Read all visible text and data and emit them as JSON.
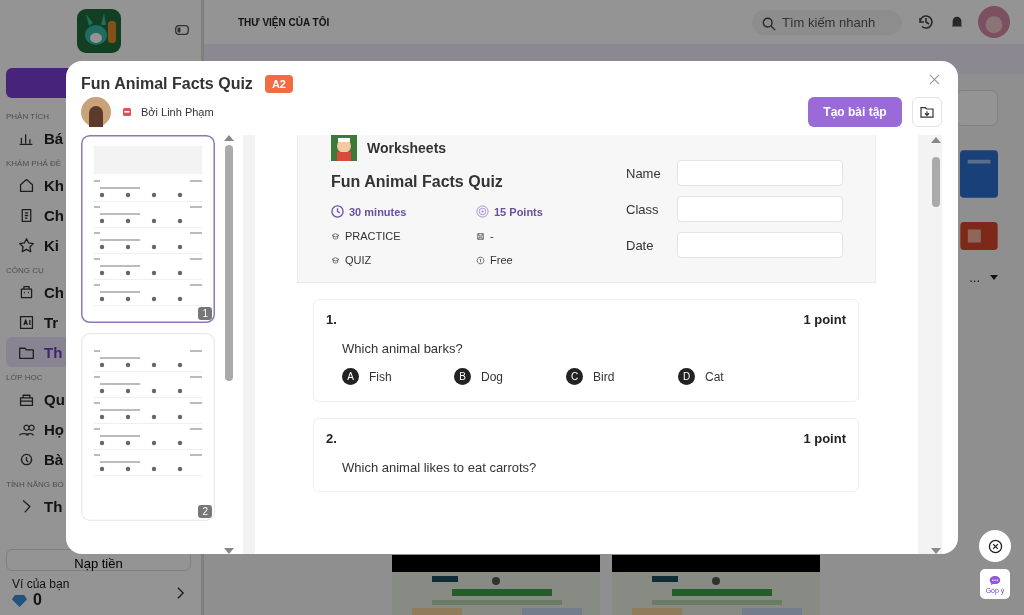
{
  "sidebar": {
    "sections": [
      {
        "heading": "PHÂN TÍCH",
        "items": [
          {
            "label": "Bá",
            "selected": false
          }
        ]
      },
      {
        "heading": "KHÁM PHÁ ĐỀ",
        "items": [
          {
            "label": "Kh",
            "selected": false
          },
          {
            "label": "Ch",
            "selected": false
          },
          {
            "label": "Ki",
            "selected": false
          }
        ]
      },
      {
        "heading": "CÔNG CỤ",
        "items": [
          {
            "label": "Ch",
            "selected": false
          },
          {
            "label": "Tr",
            "selected": false
          },
          {
            "label": "Th",
            "selected": true
          }
        ]
      },
      {
        "heading": "LỚP HỌC",
        "items": [
          {
            "label": "Qu",
            "selected": false
          },
          {
            "label": "Họ",
            "selected": false
          },
          {
            "label": "Bà",
            "selected": false
          }
        ]
      },
      {
        "heading": "TÍNH NĂNG BỔ",
        "items": [
          {
            "label": "Th",
            "selected": false
          }
        ]
      }
    ],
    "topup_button": "Nạp tiền",
    "wallet": {
      "label": "Ví của bạn",
      "balance": "0"
    }
  },
  "header": {
    "title": "THƯ VIỆN CỦA TÔI",
    "search": {
      "placeholder": "Tìm kiếm nhanh"
    }
  },
  "side_dropdown": "...",
  "modal": {
    "title": "Fun Animal Facts Quiz",
    "level_badge": "A2",
    "author": "Bởi Linh Phạm",
    "create_button": "Tạo bài tập",
    "pages": [
      {
        "number": "1",
        "selected": true
      },
      {
        "number": "2",
        "selected": false
      }
    ],
    "worksheet": {
      "brand": "Worksheets",
      "title": "Fun Animal Facts Quiz",
      "duration": "30 minutes",
      "points": "15 Points",
      "meta": [
        "PRACTICE",
        "-",
        "QUIZ",
        "Free"
      ],
      "fields": [
        "Name",
        "Class",
        "Date"
      ],
      "questions": [
        {
          "number": "1.",
          "points": "1 point",
          "text": "Which animal barks?",
          "options": [
            {
              "letter": "A",
              "text": "Fish"
            },
            {
              "letter": "B",
              "text": "Dog"
            },
            {
              "letter": "C",
              "text": "Bird"
            },
            {
              "letter": "D",
              "text": "Cat"
            }
          ]
        },
        {
          "number": "2.",
          "points": "1 point",
          "text": "Which animal likes to eat carrots?"
        }
      ]
    }
  },
  "feedback_button": "Góp ý"
}
